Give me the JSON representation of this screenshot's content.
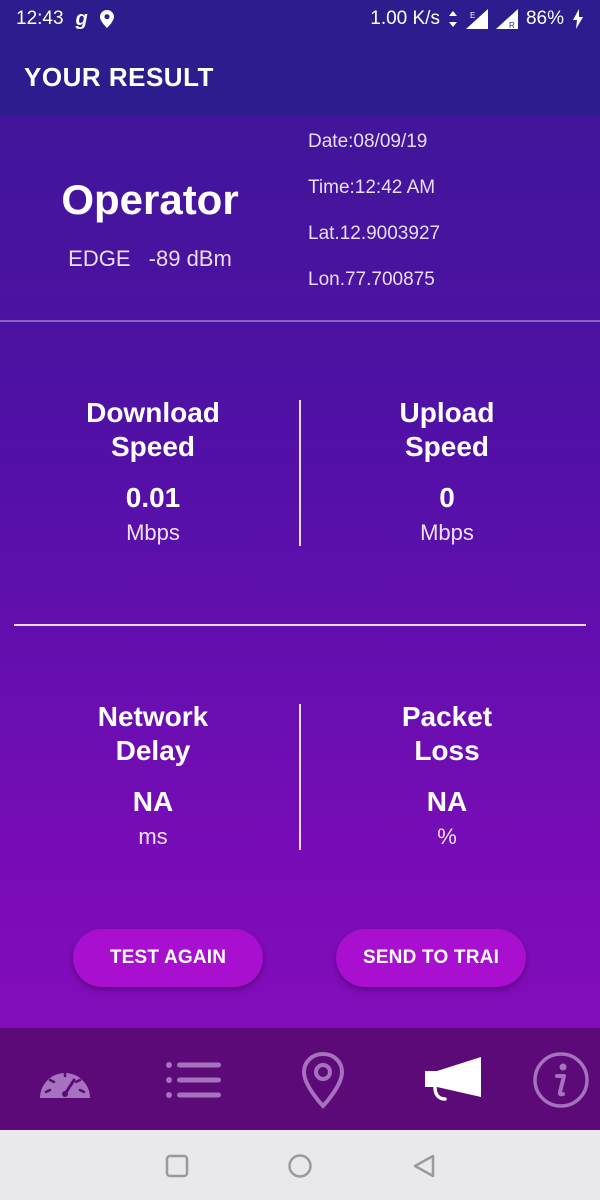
{
  "status_bar": {
    "time": "12:43",
    "network_speed": "1.00 K/s",
    "battery": "86%",
    "icons": [
      "g-app-icon",
      "location-pin-icon",
      "data-arrows-icon",
      "signal-e-icon",
      "signal-r-icon",
      "battery-charging-icon"
    ]
  },
  "app_bar": {
    "title": "YOUR RESULT"
  },
  "operator": {
    "name": "Operator",
    "network_type": "EDGE",
    "signal": "-89 dBm",
    "date": "Date:08/09/19",
    "time": "Time:12:42 AM",
    "lat": "Lat.12.9003927",
    "lon": "Lon.77.700875"
  },
  "metrics": {
    "download": {
      "label_line1": "Download",
      "label_line2": "Speed",
      "value": "0.01",
      "unit": "Mbps"
    },
    "upload": {
      "label_line1": "Upload",
      "label_line2": "Speed",
      "value": "0",
      "unit": "Mbps"
    },
    "delay": {
      "label_line1": "Network",
      "label_line2": "Delay",
      "value": "NA",
      "unit": "ms"
    },
    "loss": {
      "label_line1": "Packet",
      "label_line2": "Loss",
      "value": "NA",
      "unit": "%"
    }
  },
  "buttons": {
    "test_again": "TEST AGAIN",
    "send_to_trai": "SEND TO TRAI"
  },
  "bottom_nav": {
    "items": [
      "speedometer-icon",
      "list-icon",
      "location-pin-icon",
      "megaphone-icon",
      "info-icon"
    ],
    "active": "megaphone-icon"
  },
  "system_nav": {
    "items": [
      "recents-square-icon",
      "home-circle-icon",
      "back-triangle-icon"
    ]
  },
  "colors": {
    "app_bar": "#2c1d8f",
    "button": "#a80fcf",
    "bottom_nav": "#5c0a78",
    "system_nav": "#e9e9ec"
  }
}
